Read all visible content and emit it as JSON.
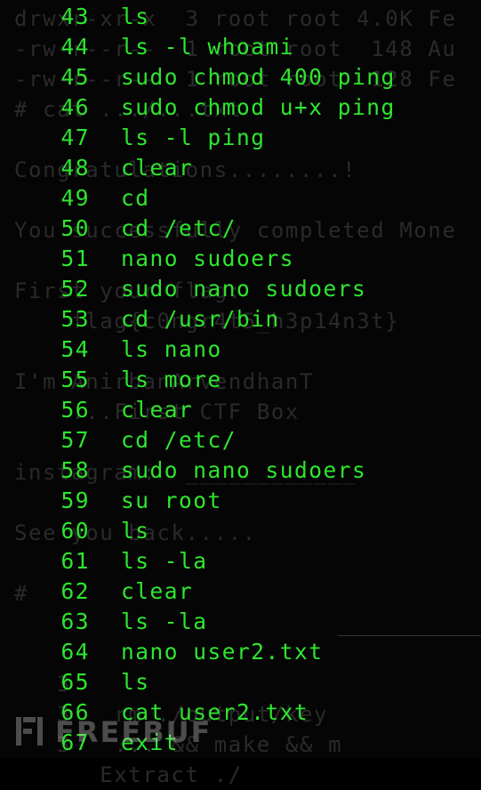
{
  "background_ghost_text": [
    "drwxr-xr-x  3 root root 4.0K Fe",
    "-rw-r--r--  1 root root  148 Au",
    "-rw-r--r--  1 root root  128 Fe",
    "# cat .../...txt",
    "",
    "Congratulations........!",
    "",
    "You successfully completed Mone",
    "",
    "First your flag:",
    "    flag{c0ngr4t5_h3p14n3t}",
    "",
    "I'm AnirbanArvendhanT",
    "    ...First CTF Box",
    "",
    "instagram:  ____________",
    "",
    "See you back.....",
    "",
    "# ",
    "",
    "",
    "   3",
    "   3   rm ./output/key",
    "   3   ... && make && m",
    "      Extract ./"
  ],
  "history": [
    {
      "num": "43",
      "cmd": "ls"
    },
    {
      "num": "44",
      "cmd": "ls -l whoami"
    },
    {
      "num": "45",
      "cmd": "sudo chmod 400 ping"
    },
    {
      "num": "46",
      "cmd": "sudo chmod u+x ping"
    },
    {
      "num": "47",
      "cmd": "ls -l ping"
    },
    {
      "num": "48",
      "cmd": "clear"
    },
    {
      "num": "49",
      "cmd": "cd"
    },
    {
      "num": "50",
      "cmd": "cd /etc/"
    },
    {
      "num": "51",
      "cmd": "nano sudoers"
    },
    {
      "num": "52",
      "cmd": "sudo nano sudoers"
    },
    {
      "num": "53",
      "cmd": "cd /usr/bin"
    },
    {
      "num": "54",
      "cmd": "ls nano"
    },
    {
      "num": "55",
      "cmd": "ls more"
    },
    {
      "num": "56",
      "cmd": "clear"
    },
    {
      "num": "57",
      "cmd": "cd /etc/"
    },
    {
      "num": "58",
      "cmd": "sudo nano sudoers"
    },
    {
      "num": "59",
      "cmd": "su root"
    },
    {
      "num": "60",
      "cmd": "ls"
    },
    {
      "num": "61",
      "cmd": "ls -la"
    },
    {
      "num": "62",
      "cmd": "clear"
    },
    {
      "num": "63",
      "cmd": "ls -la"
    },
    {
      "num": "64",
      "cmd": "nano user2.txt"
    },
    {
      "num": "65",
      "cmd": "ls"
    },
    {
      "num": "66",
      "cmd": "cat user2.txt"
    },
    {
      "num": "67",
      "cmd": "exit"
    }
  ],
  "watermark": {
    "text": "FREEBUF"
  },
  "colors": {
    "text": "#2ee62e",
    "background": "#050505",
    "ghost": "#2a2a2a"
  }
}
